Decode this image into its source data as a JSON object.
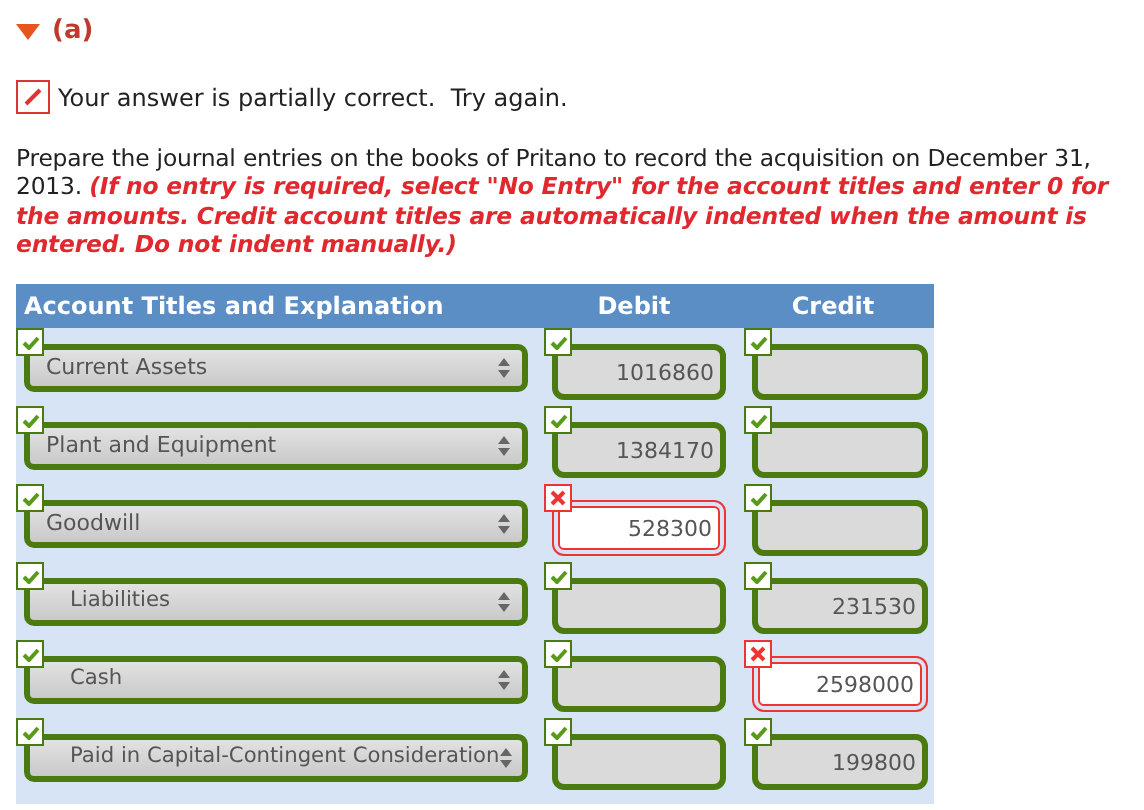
{
  "part": {
    "label": "(a)",
    "expanded": true
  },
  "status": {
    "text": "Your answer is partially correct.  Try again."
  },
  "instructions": "Prepare the journal entries on the books of Pritano to record the acquisition on December 31, 2013. **(If no entry is required, select \"No Entry\" for the account titles and enter 0 for the amounts. Credit account titles are automatically indented when the amount is entered. Do not indent manually.)**",
  "table": {
    "columns": [
      "Account Titles and Explanation",
      "Debit",
      "Credit"
    ],
    "rows": [
      {
        "account": {
          "text": "Current Assets",
          "indented": false,
          "correct": true
        },
        "debit": {
          "value": "1016860",
          "correct": true
        },
        "credit": {
          "correct": true
        }
      },
      {
        "account": {
          "text": "Plant and Equipment",
          "indented": false,
          "correct": true
        },
        "debit": {
          "value": "1384170",
          "correct": true
        },
        "credit": {
          "correct": true
        }
      },
      {
        "account": {
          "text": "Goodwill",
          "indented": false,
          "correct": true
        },
        "debit": {
          "value": "528300",
          "correct": false
        },
        "credit": {
          "correct": true
        }
      },
      {
        "account": {
          "text": "Liabilities",
          "indented": true,
          "correct": true
        },
        "debit": {
          "correct": true
        },
        "credit": {
          "value": "231530",
          "correct": true
        }
      },
      {
        "account": {
          "text": "Cash",
          "indented": true,
          "correct": true
        },
        "debit": {
          "correct": true
        },
        "credit": {
          "value": "2598000",
          "correct": false
        }
      },
      {
        "account": {
          "text": "Paid in Capital-Contingent Consideration",
          "indented": true,
          "correct": true
        },
        "debit": {
          "correct": true
        },
        "credit": {
          "value": "199800",
          "correct": true
        }
      }
    ]
  }
}
